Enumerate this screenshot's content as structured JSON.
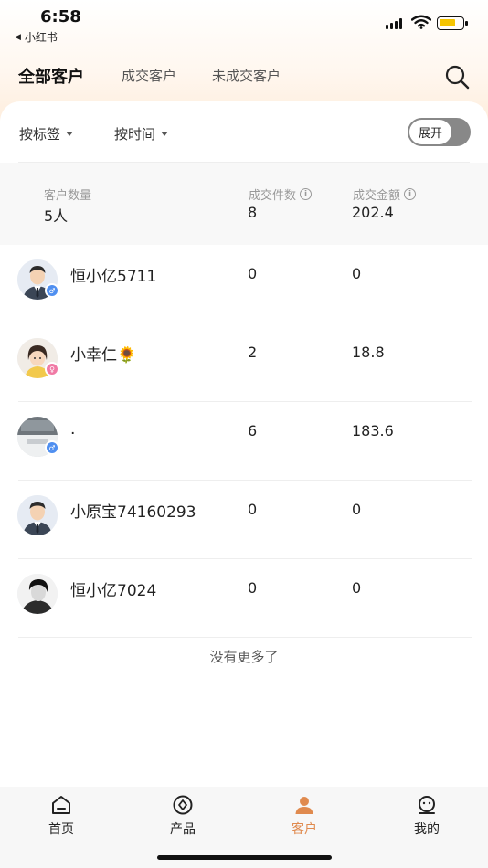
{
  "status_bar": {
    "time": "6:58",
    "back_app": "小红书"
  },
  "header": {
    "tabs": [
      {
        "label": "全部客户",
        "active": true
      },
      {
        "label": "成交客户",
        "active": false
      },
      {
        "label": "未成交客户",
        "active": false
      }
    ]
  },
  "filters": {
    "tag_label": "按标签",
    "time_label": "按时间",
    "toggle_label": "展开"
  },
  "summary": {
    "customers_label": "客户数量",
    "customers_value": "5人",
    "deals_label": "成交件数",
    "deals_value": "8",
    "amount_label": "成交金额",
    "amount_value": "202.4"
  },
  "customers": [
    {
      "name": "恒小亿5711",
      "deals": "0",
      "amount": "0",
      "gender": "male",
      "avatar": "business-avatar"
    },
    {
      "name": "小幸仁🌻",
      "deals": "2",
      "amount": "18.8",
      "gender": "female",
      "avatar": "girl-avatar"
    },
    {
      "name": ".",
      "deals": "6",
      "amount": "183.6",
      "gender": "male",
      "avatar": "photo-avatar"
    },
    {
      "name": "小原宝74160293",
      "deals": "0",
      "amount": "0",
      "gender": "none",
      "avatar": "business-avatar"
    },
    {
      "name": "恒小亿7024",
      "deals": "0",
      "amount": "0",
      "gender": "none",
      "avatar": "photo-bw-avatar"
    }
  ],
  "footer_text": "没有更多了",
  "bottom_nav": [
    {
      "label": "首页",
      "icon": "home-icon",
      "active": false
    },
    {
      "label": "产品",
      "icon": "product-icon",
      "active": false
    },
    {
      "label": "客户",
      "icon": "customer-icon",
      "active": true
    },
    {
      "label": "我的",
      "icon": "profile-icon",
      "active": false
    }
  ],
  "colors": {
    "accent": "#e08a4e",
    "header_gradient": "#fde6cf",
    "male_badge": "#4f8ff0",
    "female_badge": "#f07aa5"
  }
}
